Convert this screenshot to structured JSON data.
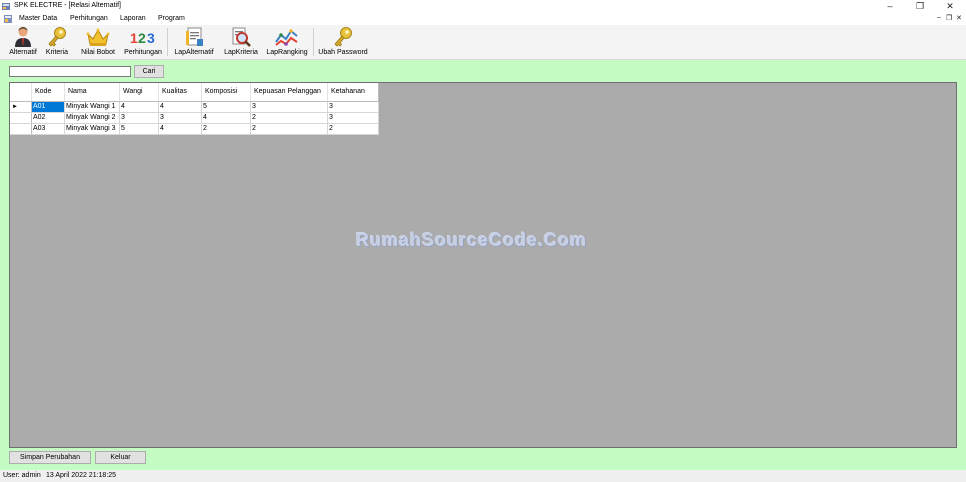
{
  "window": {
    "title": "SPK ELECTRE - [Relasi Alternatif]",
    "minimize": "–",
    "restore": "❐",
    "close": "✕",
    "mdi_minimize": "–",
    "mdi_restore": "❐",
    "mdi_close": "✕"
  },
  "menu": [
    "Master Data",
    "Perhitungan",
    "Laporan",
    "Program"
  ],
  "toolbar": [
    {
      "label": "Alternatif",
      "icon": "user-icon"
    },
    {
      "label": "Kriteria",
      "icon": "key-icon"
    },
    {
      "label": "Nilai Bobot",
      "icon": "crown-icon"
    },
    {
      "label": "Perhitungan",
      "icon": "numbers-icon"
    },
    {
      "label": "LapAlternatif",
      "icon": "report-icon"
    },
    {
      "label": "LapKriteria",
      "icon": "magnifier-report-icon"
    },
    {
      "label": "LapRangking",
      "icon": "chart-icon"
    },
    {
      "label": "Ubah Password",
      "icon": "key-icon"
    }
  ],
  "search": {
    "value": "",
    "button": "Cari"
  },
  "grid": {
    "columns": [
      "Kode",
      "Nama",
      "Wangi",
      "Kualitas",
      "Komposisi",
      "Kepuasan Pelanggan",
      "Ketahanan"
    ],
    "current_row_marker": "►",
    "rows": [
      [
        "A01",
        "Minyak Wangi 1",
        "4",
        "4",
        "5",
        "3",
        "3"
      ],
      [
        "A02",
        "Minyak Wangi 2",
        "3",
        "3",
        "4",
        "2",
        "3"
      ],
      [
        "A03",
        "Minyak Wangi 3",
        "5",
        "4",
        "2",
        "2",
        "2"
      ]
    ]
  },
  "watermark": "RumahSourceCode.Com",
  "buttons": {
    "save": "Simpan Perubahan",
    "exit": "Keluar"
  },
  "status": {
    "user": "User: admin",
    "datetime": "13 April 2022 21:18:25"
  }
}
